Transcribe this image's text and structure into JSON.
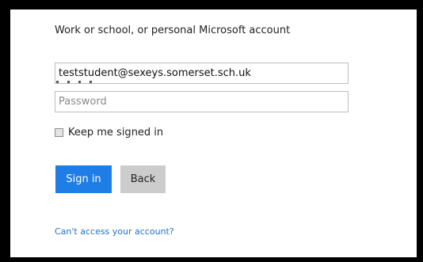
{
  "form": {
    "heading": "Work or school, or personal Microsoft account",
    "email_value": "teststudent@sexeys.somerset.sch.uk",
    "password_placeholder": "Password",
    "keep_signed_in_label": "Keep me signed in",
    "keep_signed_in_checked": false,
    "sign_in_label": "Sign in",
    "back_label": "Back",
    "help_link_label": "Can't access your account?"
  },
  "colors": {
    "background": "#000000",
    "panel": "#ffffff",
    "primary_button": "#1e7ee6",
    "secondary_button": "#cccccc",
    "link": "#1e6fc8"
  }
}
